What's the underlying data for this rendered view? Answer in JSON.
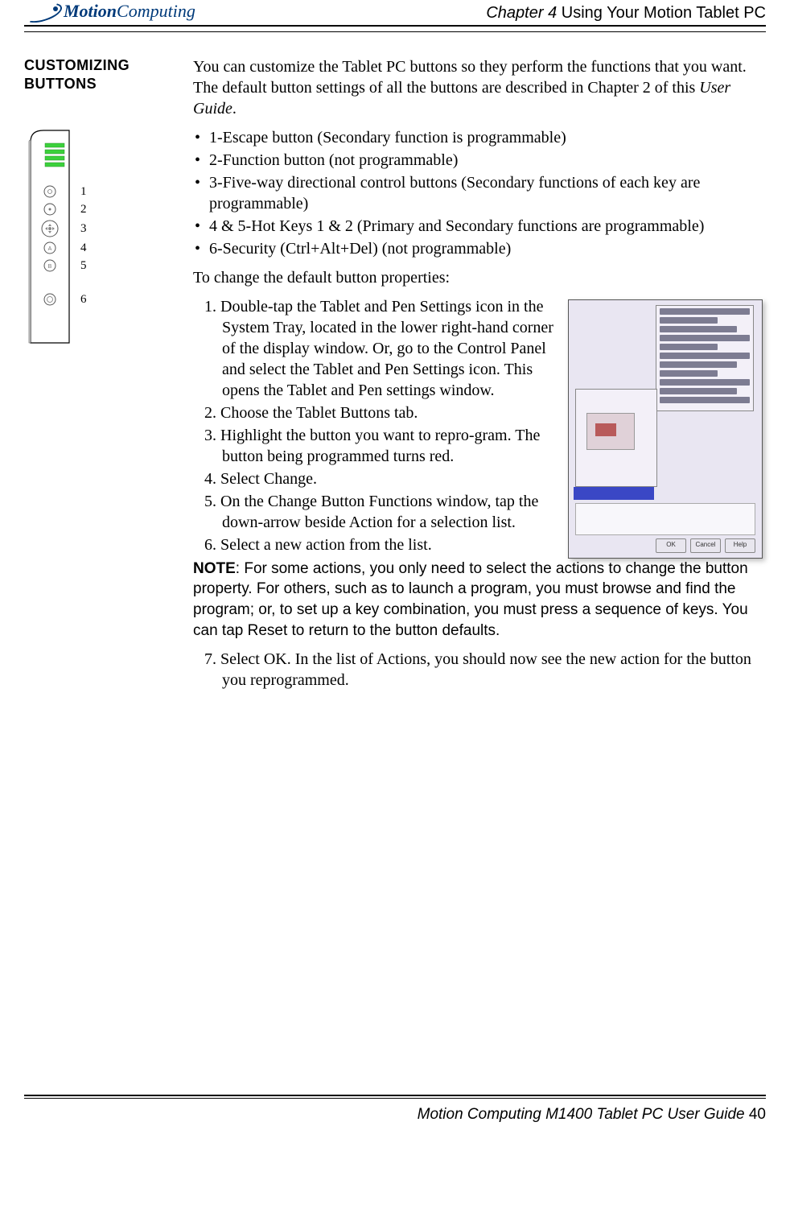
{
  "header": {
    "logo_part1": "Motion",
    "logo_part2": "Computing",
    "chapter_label": "Chapter 4",
    "chapter_title": " Using Your Motion Tablet PC"
  },
  "section_heading": "CUSTOMIZING BUTTONS",
  "intro_1": "You can customize the Tablet PC buttons so they perform the functions that you want. The default button settings of all the buttons are described in Chapter 2 of this ",
  "intro_italic": "User Guide",
  "intro_2": ".",
  "bullets": [
    "1-Escape button (Secondary function is programmable)",
    "2-Function button (not programmable)",
    "3-Five-way directional control buttons (Secondary functions of each key are programmable)",
    "4 & 5-Hot Keys 1 & 2 (Primary and Secondary functions are programmable)",
    "6-Security (Ctrl+Alt+Del) (not programmable)"
  ],
  "change_intro": "To change the default button properties:",
  "steps": [
    "1. Double-tap the Tablet and Pen Settings icon in the System Tray, located in the lower right-hand corner of the display window. Or, go to the Control Panel and select the Tablet and Pen Settings icon. This opens the Tablet and Pen settings window.",
    "2. Choose the Tablet Buttons tab.",
    "3. Highlight the button you want to repro-gram. The button being programmed turns red.",
    "4. Select Change.",
    "5. On the Change Button Functions window, tap the down-arrow beside Action for a selection list.",
    "6. Select a new action from the list."
  ],
  "note_label": "NOTE",
  "note_body": ": For some actions, you only need to select the actions to change the button property. For others, such as to launch a program, you must browse and find the program; or, to set up a key combination, you must press a sequence of keys. You can tap Reset to return to the button defaults.",
  "step7": "7. Select OK. In the list of Actions, you should now see the new action for the button you reprogrammed.",
  "diagram_labels": [
    "1",
    "2",
    "3",
    "4",
    "5",
    "6"
  ],
  "footer": {
    "text": "Motion Computing M1400 Tablet PC User Guide",
    "page": " 40"
  },
  "screenshot_buttons": [
    "OK",
    "Cancel",
    "Help"
  ]
}
